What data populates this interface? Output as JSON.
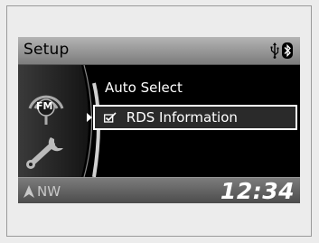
{
  "header": {
    "title": "Setup"
  },
  "status": {
    "usb_icon": "usb-icon",
    "bluetooth_icon": "bluetooth-icon"
  },
  "side_panel": {
    "source_badge": "FM",
    "icon": "wrench-icon"
  },
  "menu": {
    "items": [
      {
        "label": "Auto Select",
        "selected": false
      },
      {
        "label": "RDS Information",
        "selected": true,
        "checked": true
      }
    ]
  },
  "footer": {
    "heading": "NW",
    "clock": "12:34"
  }
}
